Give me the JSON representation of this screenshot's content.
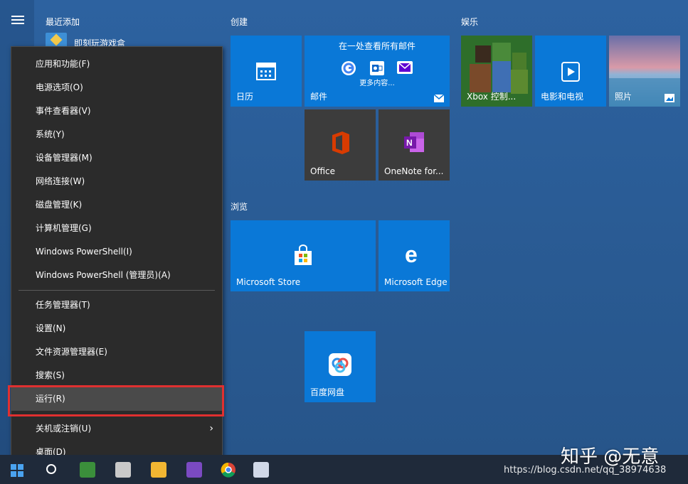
{
  "start": {
    "recent_title": "最近添加",
    "recent_app": "即刻玩游戏盒",
    "groups": {
      "create": "创建",
      "entertainment": "娱乐",
      "browse": "浏览"
    }
  },
  "tiles": {
    "calendar": "日历",
    "mail_heading": "在一处查看所有邮件",
    "mail_more": "更多内容...",
    "mail": "邮件",
    "office": "Office",
    "onenote": "OneNote for...",
    "xbox": "Xbox 控制...",
    "movies": "电影和电视",
    "photos": "照片",
    "store": "Microsoft Store",
    "edge": "Microsoft Edge",
    "baidu": "百度网盘"
  },
  "context_menu": {
    "items": [
      "应用和功能(F)",
      "电源选项(O)",
      "事件查看器(V)",
      "系统(Y)",
      "设备管理器(M)",
      "网络连接(W)",
      "磁盘管理(K)",
      "计算机管理(G)",
      "Windows PowerShell(I)",
      "Windows PowerShell (管理员)(A)",
      "任务管理器(T)",
      "设置(N)",
      "文件资源管理器(E)",
      "搜索(S)",
      "运行(R)",
      "关机或注销(U)",
      "桌面(D)"
    ]
  },
  "watermark": {
    "zhihu": "知乎 @无意",
    "url": "https://blog.csdn.net/qq_38974638"
  },
  "colors": {
    "accent": "#0a78d7",
    "highlight": "#e03030",
    "menu_bg": "#2b2b2b"
  }
}
